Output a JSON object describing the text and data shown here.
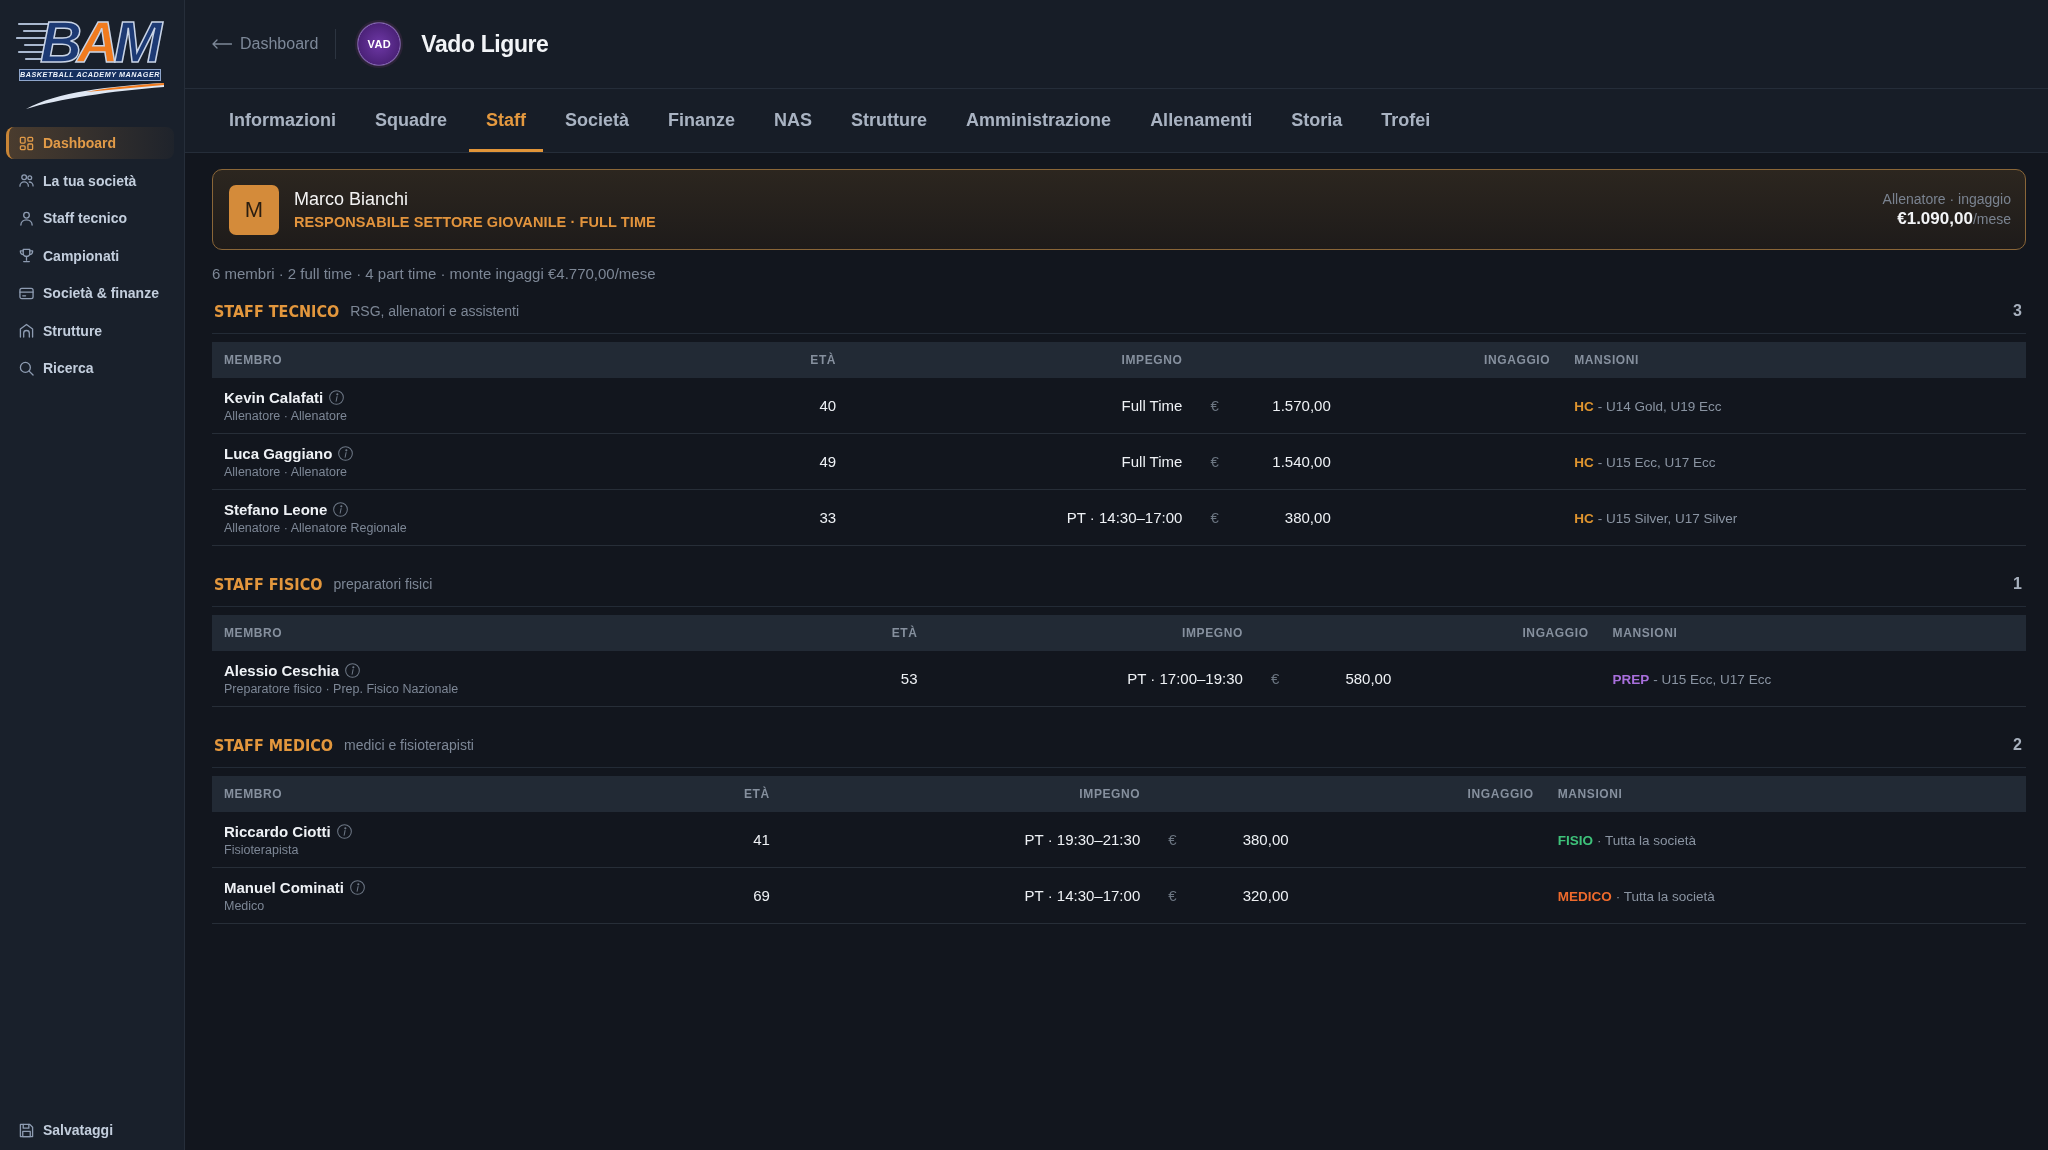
{
  "sidebar": {
    "logo": {
      "title": "BAM",
      "subtitle": "BASKETBALL ACADEMY MANAGER"
    },
    "items": [
      {
        "label": "Dashboard",
        "selected": true
      },
      {
        "label": "La tua società",
        "selected": false
      },
      {
        "label": "Staff tecnico",
        "selected": false
      },
      {
        "label": "Campionati",
        "selected": false
      },
      {
        "label": "Società & finanze",
        "selected": false
      },
      {
        "label": "Strutture",
        "selected": false
      },
      {
        "label": "Ricerca",
        "selected": false
      }
    ],
    "footer_item": {
      "label": "Salvataggi"
    }
  },
  "header": {
    "back_link": "Dashboard",
    "club_badge": "VAD",
    "club_name": "Vado Ligure"
  },
  "tabs": [
    {
      "label": "Informazioni",
      "selected": false
    },
    {
      "label": "Squadre",
      "selected": false
    },
    {
      "label": "Staff",
      "selected": true
    },
    {
      "label": "Società",
      "selected": false
    },
    {
      "label": "Finanze",
      "selected": false
    },
    {
      "label": "NAS",
      "selected": false
    },
    {
      "label": "Strutture",
      "selected": false
    },
    {
      "label": "Amministrazione",
      "selected": false
    },
    {
      "label": "Allenamenti",
      "selected": false
    },
    {
      "label": "Storia",
      "selected": false
    },
    {
      "label": "Trofei",
      "selected": false
    }
  ],
  "profile_card": {
    "initial": "M",
    "name": "Marco Bianchi",
    "role": "RESPONSABILE SETTORE GIOVANILE · FULL TIME",
    "salary_label": "Allenatore · ingaggio",
    "salary": "€1.090,00",
    "salary_unit": "/mese"
  },
  "summary": "6 membri · 2 full time · 4 part time · monte ingaggi €4.770,00/mese",
  "sections": [
    {
      "title": "STAFF TECNICO",
      "subtitle": "RSG, allenatori e assistenti",
      "count": "3",
      "columns": [
        "MEMBRO",
        "ETÀ",
        "IMPEGNO",
        "INGAGGIO",
        "MANSIONI"
      ],
      "rows": [
        {
          "name": "Kevin Calafati",
          "details": "Allenatore · Allenatore",
          "age": "40",
          "commitment": "Full Time",
          "currency": "€",
          "salary": "1.570,00",
          "duty": {
            "role": "HC",
            "color": "#e0952f",
            "detail": "- U14 Gold, U19 Ecc"
          }
        },
        {
          "name": "Luca Gaggiano",
          "details": "Allenatore · Allenatore",
          "age": "49",
          "commitment": "Full Time",
          "currency": "€",
          "salary": "1.540,00",
          "duty": {
            "role": "HC",
            "color": "#e0952f",
            "detail": "- U15 Ecc, U17 Ecc"
          }
        },
        {
          "name": "Stefano Leone",
          "details": "Allenatore · Allenatore Regionale",
          "age": "33",
          "commitment": "PT · 14:30–17:00",
          "currency": "€",
          "salary": "380,00",
          "duty": {
            "role": "HC",
            "color": "#e0952f",
            "detail": "- U15 Silver, U17 Silver"
          }
        }
      ]
    },
    {
      "title": "STAFF FISICO",
      "subtitle": "preparatori fisici",
      "count": "1",
      "columns": [
        "MEMBRO",
        "ETÀ",
        "IMPEGNO",
        "INGAGGIO",
        "MANSIONI"
      ],
      "rows": [
        {
          "name": "Alessio Ceschia",
          "details": "Preparatore fisico · Prep. Fisico Nazionale",
          "age": "53",
          "commitment": "PT · 17:00–19:30",
          "currency": "€",
          "salary": "580,00",
          "duty": {
            "role": "PREP",
            "color": "#a86fdc",
            "detail": "- U15 Ecc, U17 Ecc"
          }
        }
      ]
    },
    {
      "title": "STAFF MEDICO",
      "subtitle": "medici e fisioterapisti",
      "count": "2",
      "columns": [
        "MEMBRO",
        "ETÀ",
        "IMPEGNO",
        "INGAGGIO",
        "MANSIONI"
      ],
      "rows": [
        {
          "name": "Riccardo Ciotti",
          "details": "Fisioterapista",
          "age": "41",
          "commitment": "PT · 19:30–21:30",
          "currency": "€",
          "salary": "380,00",
          "duty": {
            "role": "FISIO",
            "color": "#3ec27a",
            "detail": "· Tutta la società"
          }
        },
        {
          "name": "Manuel Cominati",
          "details": "Medico",
          "age": "69",
          "commitment": "PT · 14:30–17:00",
          "currency": "€",
          "salary": "320,00",
          "duty": {
            "role": "MEDICO",
            "color": "#ee6a2c",
            "detail": "· Tutta la società"
          }
        }
      ]
    }
  ]
}
